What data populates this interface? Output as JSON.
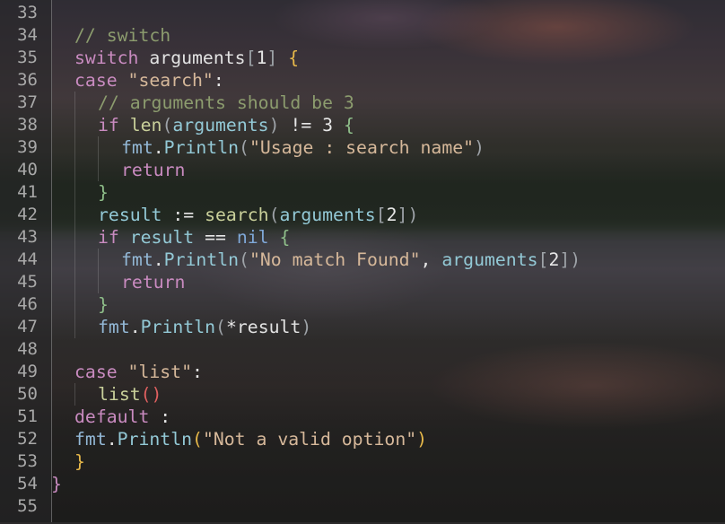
{
  "editor": {
    "language": "go",
    "lines": [
      {
        "no": "33",
        "indent": 0,
        "tokens": []
      },
      {
        "no": "34",
        "indent": 1,
        "tokens": [
          {
            "t": "// switch",
            "k": "comment"
          }
        ]
      },
      {
        "no": "35",
        "indent": 1,
        "tokens": [
          {
            "t": "switch ",
            "k": "kw"
          },
          {
            "t": "arguments",
            "k": "ident"
          },
          {
            "t": "[",
            "k": "brk"
          },
          {
            "t": "1",
            "k": "num"
          },
          {
            "t": "]",
            "k": "brk"
          },
          {
            "t": " ",
            "k": "op"
          },
          {
            "t": "{",
            "k": "brk-gold"
          }
        ]
      },
      {
        "no": "36",
        "indent": 1,
        "tokens": [
          {
            "t": "case ",
            "k": "kw"
          },
          {
            "t": "\"search\"",
            "k": "str"
          },
          {
            "t": ":",
            "k": "op"
          }
        ]
      },
      {
        "no": "37",
        "indent": 2,
        "tokens": [
          {
            "t": "// arguments should be 3",
            "k": "comment"
          }
        ]
      },
      {
        "no": "38",
        "indent": 2,
        "tokens": [
          {
            "t": "if ",
            "k": "kw"
          },
          {
            "t": "len",
            "k": "fn"
          },
          {
            "t": "(",
            "k": "brk"
          },
          {
            "t": "arguments",
            "k": "call"
          },
          {
            "t": ")",
            "k": "brk"
          },
          {
            "t": " != 3 ",
            "k": "op"
          },
          {
            "t": "{",
            "k": "brk-green"
          }
        ]
      },
      {
        "no": "39",
        "indent": 3,
        "tokens": [
          {
            "t": "fmt",
            "k": "pkg"
          },
          {
            "t": ".",
            "k": "op"
          },
          {
            "t": "Println",
            "k": "call"
          },
          {
            "t": "(",
            "k": "brk"
          },
          {
            "t": "\"Usage : search name\"",
            "k": "str"
          },
          {
            "t": ")",
            "k": "brk"
          }
        ]
      },
      {
        "no": "40",
        "indent": 3,
        "tokens": [
          {
            "t": "return",
            "k": "kw"
          }
        ]
      },
      {
        "no": "41",
        "indent": 2,
        "tokens": [
          {
            "t": "}",
            "k": "brk-green"
          }
        ]
      },
      {
        "no": "42",
        "indent": 2,
        "tokens": [
          {
            "t": "result",
            "k": "call"
          },
          {
            "t": " := ",
            "k": "op"
          },
          {
            "t": "search",
            "k": "fn"
          },
          {
            "t": "(",
            "k": "brk"
          },
          {
            "t": "arguments",
            "k": "call"
          },
          {
            "t": "[",
            "k": "brk"
          },
          {
            "t": "2",
            "k": "num"
          },
          {
            "t": "]",
            "k": "brk"
          },
          {
            "t": ")",
            "k": "brk"
          }
        ]
      },
      {
        "no": "43",
        "indent": 2,
        "tokens": [
          {
            "t": "if ",
            "k": "kw"
          },
          {
            "t": "result",
            "k": "call"
          },
          {
            "t": " == ",
            "k": "op"
          },
          {
            "t": "nil",
            "k": "nil"
          },
          {
            "t": " ",
            "k": "op"
          },
          {
            "t": "{",
            "k": "brk-green"
          }
        ]
      },
      {
        "no": "44",
        "indent": 3,
        "tokens": [
          {
            "t": "fmt",
            "k": "pkg"
          },
          {
            "t": ".",
            "k": "op"
          },
          {
            "t": "Println",
            "k": "call"
          },
          {
            "t": "(",
            "k": "brk"
          },
          {
            "t": "\"No match Found\"",
            "k": "str"
          },
          {
            "t": ", ",
            "k": "op"
          },
          {
            "t": "arguments",
            "k": "call"
          },
          {
            "t": "[",
            "k": "brk"
          },
          {
            "t": "2",
            "k": "num"
          },
          {
            "t": "]",
            "k": "brk"
          },
          {
            "t": ")",
            "k": "brk"
          }
        ]
      },
      {
        "no": "45",
        "indent": 3,
        "tokens": [
          {
            "t": "return",
            "k": "kw"
          }
        ]
      },
      {
        "no": "46",
        "indent": 2,
        "tokens": [
          {
            "t": "}",
            "k": "brk-green"
          }
        ]
      },
      {
        "no": "47",
        "indent": 2,
        "tokens": [
          {
            "t": "fmt",
            "k": "pkg"
          },
          {
            "t": ".",
            "k": "op"
          },
          {
            "t": "Println",
            "k": "call"
          },
          {
            "t": "(",
            "k": "brk"
          },
          {
            "t": "*",
            "k": "op"
          },
          {
            "t": "result",
            "k": "ident"
          },
          {
            "t": ")",
            "k": "brk"
          }
        ]
      },
      {
        "no": "48",
        "indent": 0,
        "tokens": []
      },
      {
        "no": "49",
        "indent": 1,
        "tokens": [
          {
            "t": "case ",
            "k": "kw"
          },
          {
            "t": "\"list\"",
            "k": "str"
          },
          {
            "t": ":",
            "k": "op"
          }
        ]
      },
      {
        "no": "50",
        "indent": 2,
        "tokens": [
          {
            "t": "list",
            "k": "fn"
          },
          {
            "t": "()",
            "k": "brk-red"
          }
        ]
      },
      {
        "no": "51",
        "indent": 1,
        "tokens": [
          {
            "t": "default",
            "k": "kw"
          },
          {
            "t": " :",
            "k": "op"
          }
        ]
      },
      {
        "no": "52",
        "indent": 1,
        "tokens": [
          {
            "t": "fmt",
            "k": "pkg"
          },
          {
            "t": ".",
            "k": "op"
          },
          {
            "t": "Println",
            "k": "call"
          },
          {
            "t": "(",
            "k": "brk-gold"
          },
          {
            "t": "\"Not a valid option\"",
            "k": "str"
          },
          {
            "t": ")",
            "k": "brk-gold"
          }
        ]
      },
      {
        "no": "53",
        "indent": 1,
        "tokens": [
          {
            "t": "}",
            "k": "brk-gold"
          }
        ]
      },
      {
        "no": "54",
        "indent": 0,
        "tokens": [
          {
            "t": "}",
            "k": "kw"
          }
        ]
      },
      {
        "no": "55",
        "indent": 0,
        "tokens": []
      }
    ]
  }
}
